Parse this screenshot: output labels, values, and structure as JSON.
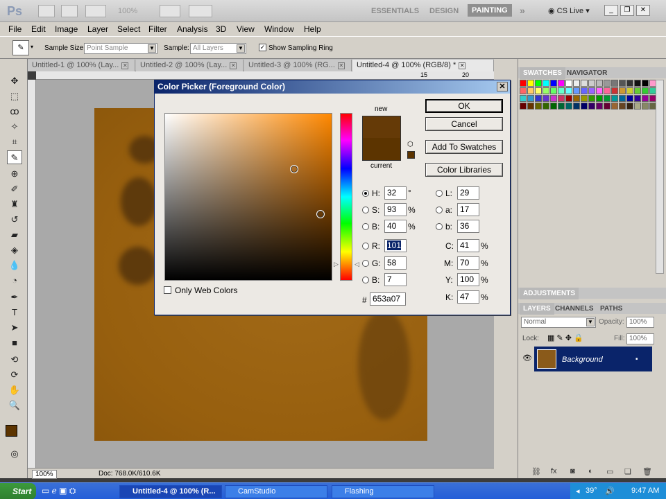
{
  "app": {
    "logo": "Ps",
    "zoom": "100%",
    "workspaces": [
      "ESSENTIALS",
      "DESIGN",
      "PAINTING"
    ],
    "active_workspace": "PAINTING",
    "cs_live": "CS Live"
  },
  "menu": [
    "File",
    "Edit",
    "Image",
    "Layer",
    "Select",
    "Filter",
    "Analysis",
    "3D",
    "View",
    "Window",
    "Help"
  ],
  "options": {
    "sample_size_label": "Sample Size:",
    "sample_size_value": "Point Sample",
    "sample_label": "Sample:",
    "sample_value": "All Layers",
    "show_ring_label": "Show Sampling Ring",
    "show_ring_checked": true
  },
  "doc_tabs": [
    {
      "label": "Untitled-1 @ 100% (Lay..."
    },
    {
      "label": "Untitled-2 @ 100% (Lay..."
    },
    {
      "label": "Untitled-3 @ 100% (RG..."
    },
    {
      "label": "Untitled-4 @ 100% (RGB/8) *"
    }
  ],
  "ruler_marks": [
    "15",
    "20"
  ],
  "status": {
    "zoom": "100%",
    "doc": "Doc: 768.0K/610.6K"
  },
  "color_picker": {
    "title": "Color Picker (Foreground Color)",
    "ok": "OK",
    "cancel": "Cancel",
    "add_swatches": "Add To Swatches",
    "color_libraries": "Color Libraries",
    "new_label": "new",
    "current_label": "current",
    "new_color": "#653a07",
    "current_color": "#5c3400",
    "only_web_colors": "Only Web Colors",
    "fields": {
      "H": "32",
      "H_unit": "°",
      "S": "93",
      "S_unit": "%",
      "B": "40",
      "B_unit": "%",
      "R": "101",
      "G": "58",
      "Bl": "7",
      "L": "29",
      "a": "17",
      "b": "36",
      "C": "41",
      "M": "70",
      "Y": "100",
      "K": "47",
      "pct": "%",
      "hex": "653a07"
    }
  },
  "panels": {
    "swatches_tab": "SWATCHES",
    "navigator_tab": "NAVIGATOR",
    "adjustments": "ADJUSTMENTS",
    "layers_tab": "LAYERS",
    "channels_tab": "CHANNELS",
    "paths_tab": "PATHS",
    "blend_mode": "Normal",
    "opacity_label": "Opacity:",
    "opacity_value": "100%",
    "lock_label": "Lock:",
    "fill_label": "Fill:",
    "fill_value": "100%",
    "layer_name": "Background"
  },
  "taskbar": {
    "start": "Start",
    "tasks": [
      "Untitled-4 @ 100% (R...",
      "CamStudio",
      "Flashing"
    ],
    "temp": "39°",
    "clock": "9:47 AM"
  },
  "colors": {
    "canvas": "#9a600f",
    "accent": "#0a246a"
  }
}
